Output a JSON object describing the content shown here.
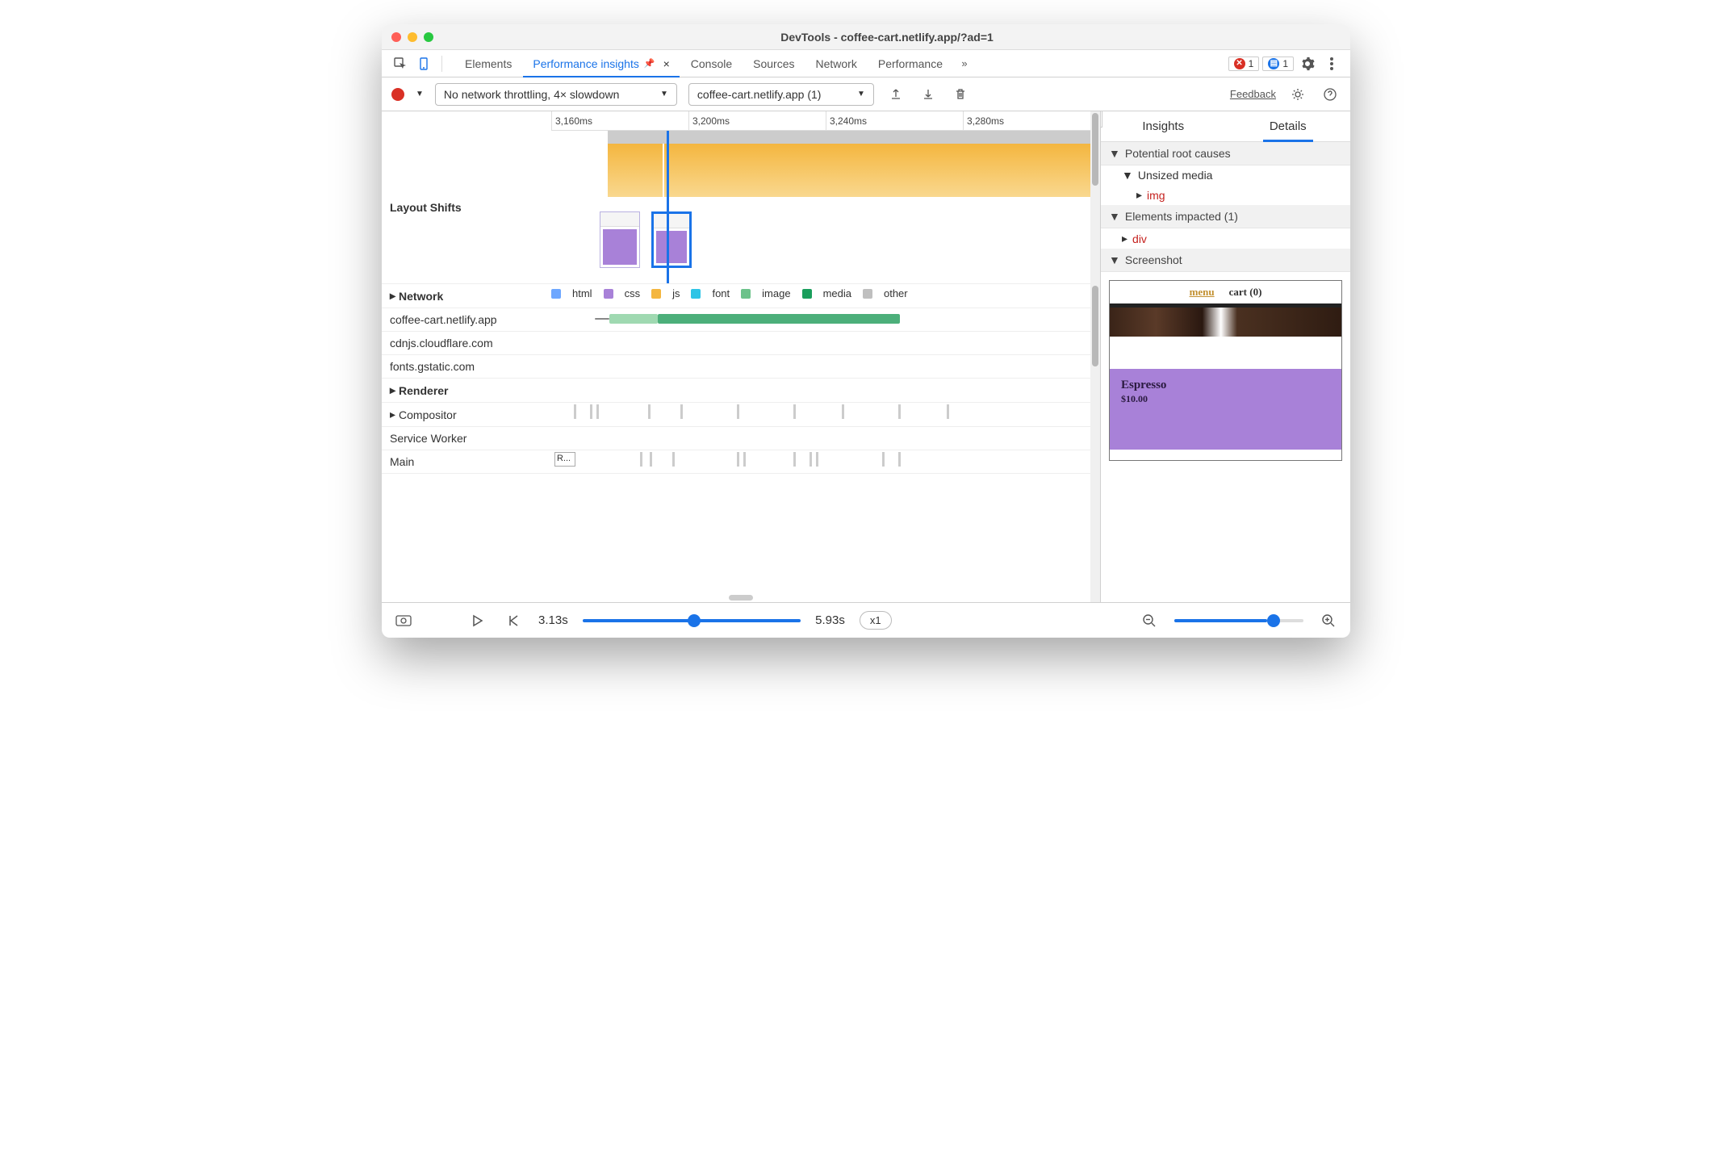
{
  "window": {
    "title": "DevTools - coffee-cart.netlify.app/?ad=1"
  },
  "tabs": {
    "items": [
      "Elements",
      "Performance insights",
      "Console",
      "Sources",
      "Network",
      "Performance"
    ],
    "active_index": 1,
    "error_count": "1",
    "info_count": "1"
  },
  "toolbar": {
    "throttle": "No network throttling, 4× slowdown",
    "recording": "coffee-cart.netlify.app (1)",
    "feedback": "Feedback"
  },
  "ruler": {
    "ticks": [
      "3,160ms",
      "3,200ms",
      "3,240ms",
      "3,280ms"
    ]
  },
  "tracks": {
    "layout_shifts": "Layout Shifts",
    "network": "Network",
    "hosts": [
      "coffee-cart.netlify.app",
      "cdnjs.cloudflare.com",
      "fonts.gstatic.com"
    ],
    "renderer": "Renderer",
    "compositor": "Compositor",
    "service_worker": "Service Worker",
    "main": "Main",
    "main_block": "R...",
    "legend": {
      "html": "html",
      "css": "css",
      "js": "js",
      "font": "font",
      "image": "image",
      "media": "media",
      "other": "other"
    }
  },
  "details": {
    "tabs": {
      "insights": "Insights",
      "details": "Details"
    },
    "root_causes": "Potential root causes",
    "unsized_media": "Unsized media",
    "img_el": "img",
    "elements_impacted": "Elements impacted (1)",
    "div_el": "div",
    "screenshot_h": "Screenshot",
    "ss_menu": "menu",
    "ss_cart": "cart (0)",
    "ss_prod": "Espresso",
    "ss_price": "$10.00"
  },
  "footer": {
    "start": "3.13s",
    "end": "5.93s",
    "speed": "x1"
  }
}
